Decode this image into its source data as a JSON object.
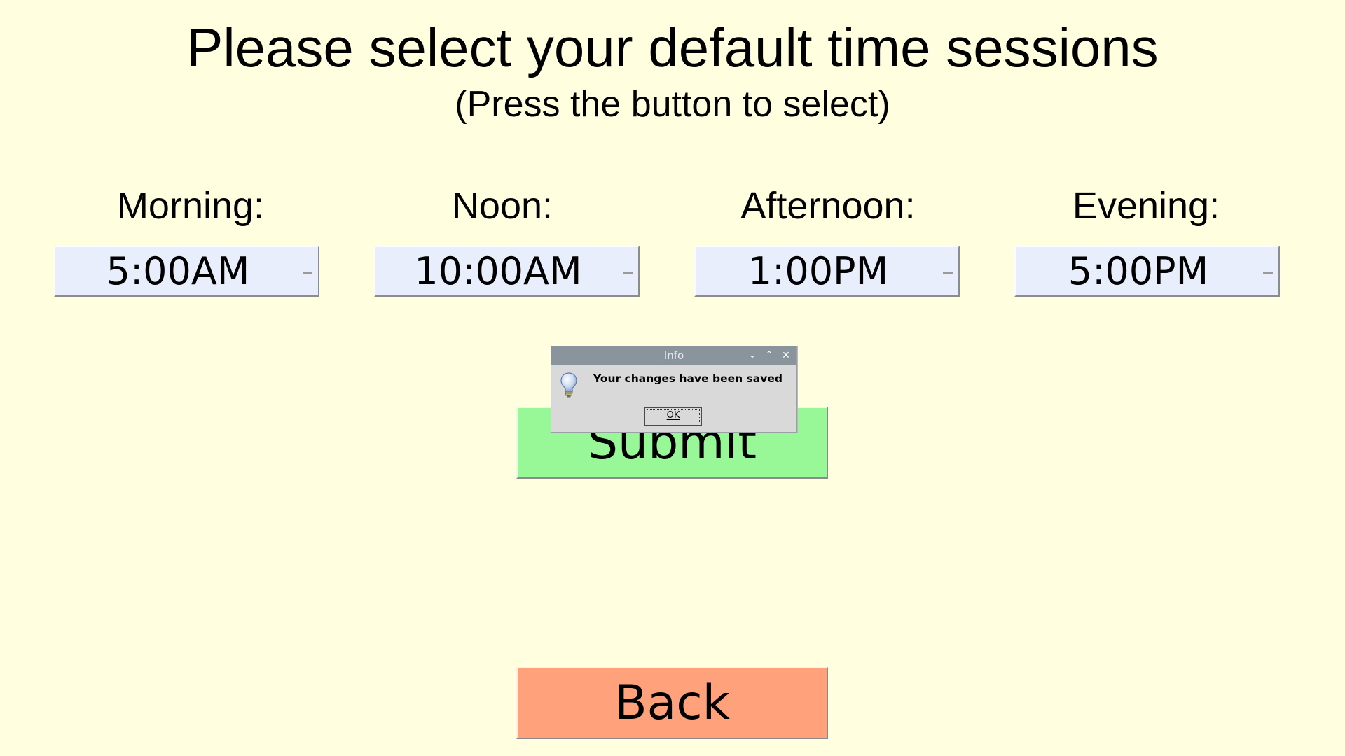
{
  "header": {
    "title": "Please select your default time sessions",
    "subtitle": "(Press the button to select)"
  },
  "sessions": [
    {
      "label": "Morning:",
      "value": "5:00AM"
    },
    {
      "label": "Noon:",
      "value": "10:00AM"
    },
    {
      "label": "Afternoon:",
      "value": "1:00PM"
    },
    {
      "label": "Evening:",
      "value": "5:00PM"
    }
  ],
  "actions": {
    "submit_label": "Submit",
    "back_label": "Back"
  },
  "dialog": {
    "title": "Info",
    "message": "Your changes have been saved",
    "ok_label": "OK",
    "icon": "lightbulb-icon",
    "window_buttons": [
      "minimize",
      "maximize",
      "close"
    ]
  },
  "colors": {
    "background": "#ffffdf",
    "time_button": "#e8eefc",
    "submit": "#98f898",
    "back": "#ffa27c",
    "dialog_titlebar": "#8a949d",
    "dialog_body": "#d9d9d9"
  }
}
